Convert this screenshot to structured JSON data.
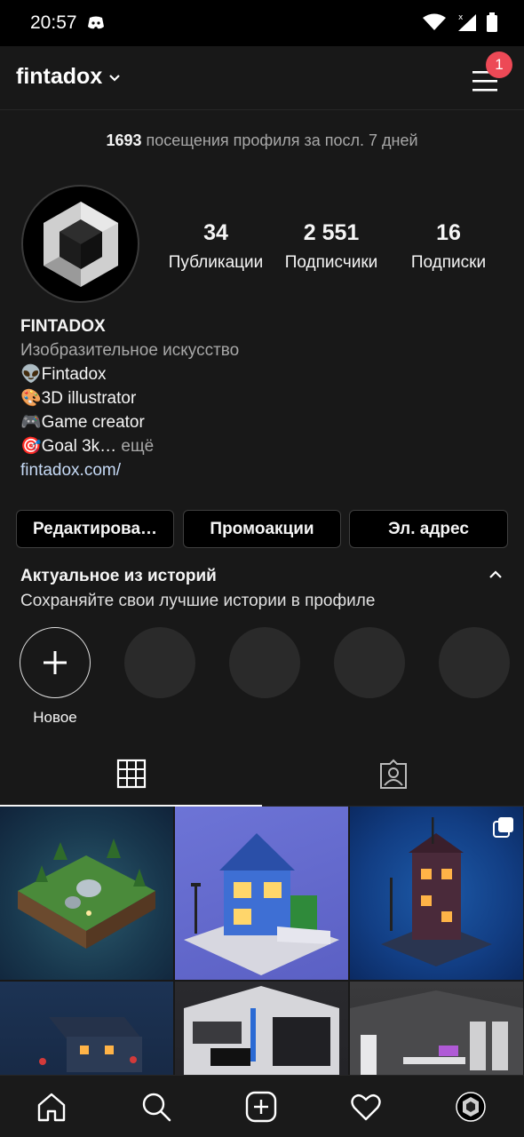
{
  "status_bar": {
    "time": "20:57"
  },
  "header": {
    "username": "fintadox",
    "notification_count": "1"
  },
  "profile": {
    "visits_count": "1693",
    "visits_text": " посещения профиля за посл. 7 дней",
    "stats": [
      {
        "value": "34",
        "label": "Публикации"
      },
      {
        "value": "2 551",
        "label": "Подписчики"
      },
      {
        "value": "16",
        "label": "Подписки"
      }
    ],
    "display_name": "FINTADOX",
    "category": "Изобразительное искусство",
    "bio_lines": [
      "👽Fintadox",
      "🎨3D illustrator",
      "🎮Game creator"
    ],
    "bio_last": "🎯Goal 3k…",
    "bio_more": " ещё",
    "website": "fintadox.com/"
  },
  "actions": {
    "edit_label": "Редактирова…",
    "promo_label": "Промоакции",
    "email_label": "Эл. адрес"
  },
  "highlights": {
    "title": "Актуальное из историй",
    "subtitle": "Сохраняйте свои лучшие истории в профиле",
    "new_label": "Новое"
  },
  "colors": {
    "badge": "#ed4956",
    "link": "#c6daf6",
    "background": "#181818"
  }
}
